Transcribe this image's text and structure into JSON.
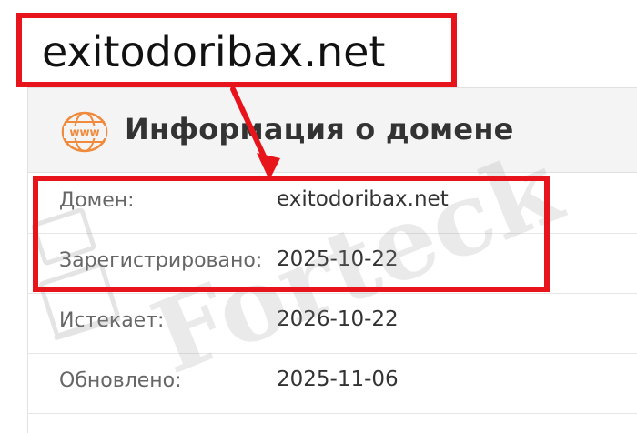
{
  "callout": {
    "domain": "exitodoribax.net"
  },
  "panel": {
    "icon": "www-globe-icon",
    "icon_text": "www",
    "title": "Информация о домене"
  },
  "rows": [
    {
      "label": "Домен:",
      "value": "exitodoribax.net"
    },
    {
      "label": "Зарегистрировано:",
      "value": "2025-10-22"
    },
    {
      "label": "Истекает:",
      "value": "2026-10-22"
    },
    {
      "label": "Обновлено:",
      "value": "2025-11-06"
    }
  ],
  "watermark": {
    "text": "Forteck"
  },
  "colors": {
    "highlight": "#e8141c",
    "icon": "#f08a3c",
    "header_bg": "#f4f4f4"
  }
}
